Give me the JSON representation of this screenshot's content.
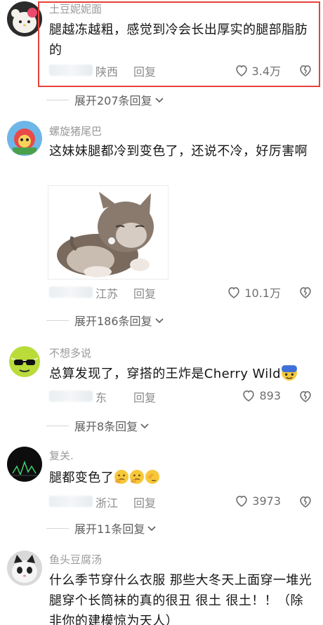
{
  "comments": [
    {
      "username": "土豆妮妮面",
      "text": "腿越冻越粗，感觉到冷会长出厚实的腿部脂肪的",
      "location": "陕西",
      "reply_label": "回复",
      "likes": "3.4万",
      "expand_label": "展开207条回复"
    },
    {
      "username": "螺旋猪尾巴",
      "text": "这妹妹腿都冷到变色了，还说不冷，好厉害啊",
      "location": "江苏",
      "reply_label": "回复",
      "likes": "10.1万",
      "expand_label": "展开186条回复"
    },
    {
      "username": "不想多说",
      "text": "总算发现了，穿搭的王炸是Cherry Wild",
      "location": "东",
      "reply_label": "回复",
      "likes": "893",
      "expand_label": "展开8条回复"
    },
    {
      "username": "复关.",
      "text": "腿都变色了",
      "location": "浙江",
      "reply_label": "回复",
      "likes": "3973",
      "expand_label": "展开11条回复"
    },
    {
      "username": "鱼头豆腐汤",
      "text": "什么季节穿什么衣服 那些大冬天上面穿一堆光腿穿个长筒袜的真的很丑 很土 很土！！（除非你的建模惊为天人）"
    }
  ],
  "icons": {
    "like": "heart-outline-icon",
    "dislike": "broken-heart-icon",
    "expand": "chevron-down-icon"
  },
  "colors": {
    "highlight_border": "#e5423b",
    "username": "#9a9a9a",
    "meta": "#8c8c8c"
  }
}
